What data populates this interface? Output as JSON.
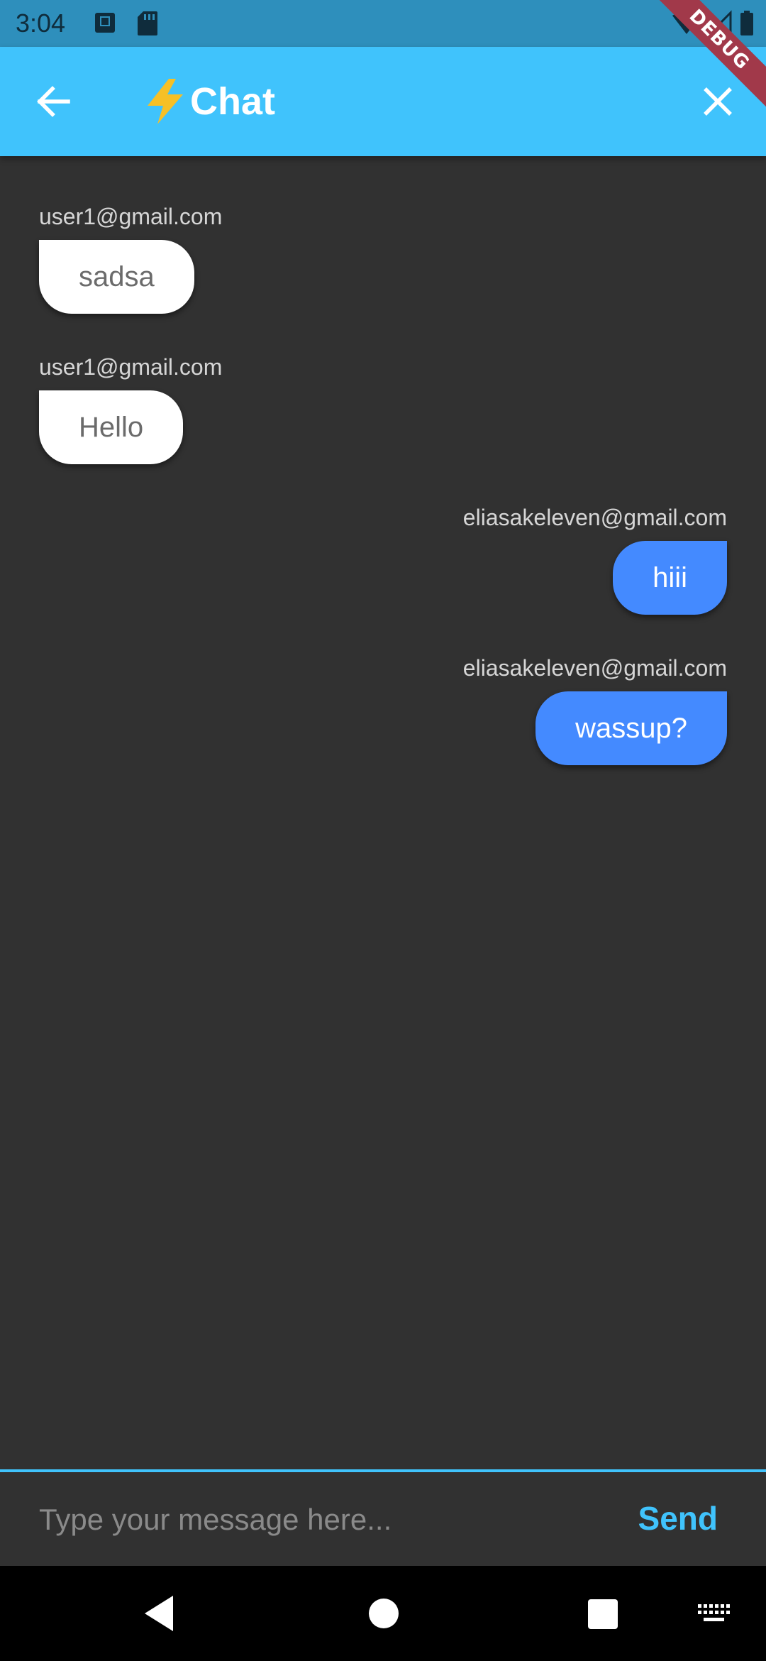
{
  "status_bar": {
    "time": "3:04",
    "icons": [
      "text-a-icon",
      "sd-card-icon",
      "wifi-icon",
      "cell-signal-icon",
      "battery-icon"
    ]
  },
  "debug_banner": "DEBUG",
  "app_bar": {
    "title": "Chat",
    "title_icon": "lightning-bolt-icon",
    "back_icon": "arrow-left-icon",
    "close_icon": "close-icon",
    "background": "#40C3FC"
  },
  "messages": [
    {
      "sender": "user1@gmail.com",
      "text": "sadsa",
      "direction": "received"
    },
    {
      "sender": "user1@gmail.com",
      "text": "Hello",
      "direction": "received"
    },
    {
      "sender": "eliasakeleven@gmail.com",
      "text": "hiii",
      "direction": "sent"
    },
    {
      "sender": "eliasakeleven@gmail.com",
      "text": "wassup?",
      "direction": "sent"
    }
  ],
  "composer": {
    "value": "",
    "placeholder": "Type your message here...",
    "send_label": "Send"
  },
  "colors": {
    "accent": "#40C3FC",
    "sent_bubble": "#448AFF",
    "received_bubble": "#FFFFFF",
    "background": "#313131"
  },
  "nav_bar": {
    "icons": [
      "nav-back-icon",
      "nav-home-icon",
      "nav-recents-icon",
      "keyboard-icon"
    ]
  }
}
